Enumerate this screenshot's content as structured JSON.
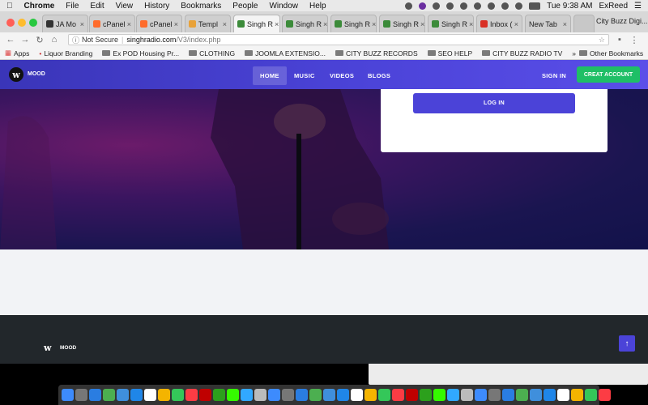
{
  "menubar": {
    "apple": "",
    "app": "Chrome",
    "items": [
      "File",
      "Edit",
      "View",
      "History",
      "Bookmarks",
      "People",
      "Window",
      "Help"
    ],
    "clock": "Tue 9:38 AM",
    "user": "ExReed"
  },
  "tabs": [
    {
      "label": "JA Mo",
      "color": "#333333"
    },
    {
      "label": "cPanel",
      "color": "#ff6c2c"
    },
    {
      "label": "cPanel",
      "color": "#ff6c2c"
    },
    {
      "label": "Templ",
      "color": "#e8a23a"
    },
    {
      "label": "Singh R",
      "color": "#3c8b3a"
    },
    {
      "label": "Singh R",
      "color": "#3c8b3a"
    },
    {
      "label": "Singh R",
      "color": "#3c8b3a"
    },
    {
      "label": "Singh R",
      "color": "#3c8b3a"
    },
    {
      "label": "Singh R",
      "color": "#3c8b3a"
    },
    {
      "label": "Inbox (",
      "color": "#d93025"
    },
    {
      "label": "New Tab",
      "color": ""
    }
  ],
  "profile_label": "City Buzz Digi...",
  "address": {
    "security": "Not Secure",
    "url_domain": "singhradio.com",
    "url_path": "/V3/index.php"
  },
  "bookmarks": {
    "apps": "Apps",
    "items": [
      "Liquor Branding",
      "Ex POD Housing Pr...",
      "CLOTHING",
      "JOOMLA EXTENSIO...",
      "CITY BUZZ RECORDS",
      "SEO HELP",
      "CITY BUZZ RADIO TV"
    ],
    "more": "»",
    "other": "Other Bookmarks"
  },
  "site": {
    "logo_glyph": "w",
    "brand": "MOOD",
    "nav": [
      "HOME",
      "MUSIC",
      "VIDEOS",
      "BLOGS"
    ],
    "active_nav": "HOME",
    "sign_in": "SIGN IN",
    "create_account": "CREAT ACCOUNT",
    "login_button": "LOG IN",
    "footer_brand": "MOOD",
    "scroll_top": "↑",
    "colors": {
      "accent": "#4b43d8",
      "create_account_bg": "#1fbf66",
      "footer_bg": "#22272b"
    }
  },
  "dock_icons": [
    {
      "name": "finder-icon",
      "color": "#3d8bfd"
    },
    {
      "name": "launchpad-icon",
      "color": "#777777"
    },
    {
      "name": "safari-icon",
      "color": "#2a7de1"
    },
    {
      "name": "chrome-icon",
      "color": "#4caf50"
    },
    {
      "name": "mail-icon",
      "color": "#3f8fdc"
    },
    {
      "name": "app-store-icon",
      "color": "#1f86e8"
    },
    {
      "name": "calendar-icon",
      "color": "#ffffff"
    },
    {
      "name": "photos-icon",
      "color": "#f4b400"
    },
    {
      "name": "messages-icon",
      "color": "#34c759"
    },
    {
      "name": "music-icon",
      "color": "#fc3c44"
    },
    {
      "name": "filezilla-icon",
      "color": "#bf0000"
    },
    {
      "name": "quickbooks-icon",
      "color": "#2ca01c"
    },
    {
      "name": "dreamweaver-icon",
      "color": "#35fa00"
    },
    {
      "name": "photoshop-icon",
      "color": "#31a8ff"
    },
    {
      "name": "trash-icon",
      "color": "#bbbbbb"
    }
  ]
}
